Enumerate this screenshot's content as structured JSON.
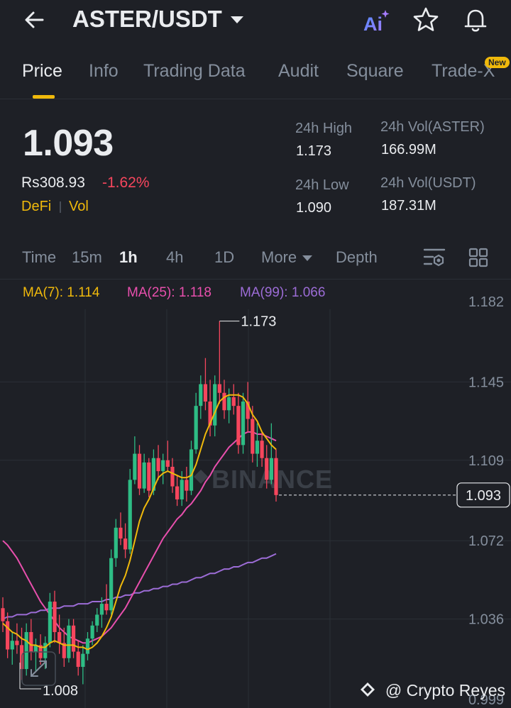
{
  "header": {
    "pair": "ASTER/USDT",
    "ai_label": "Ai"
  },
  "tabs": [
    {
      "label": "Price",
      "active": true
    },
    {
      "label": "Info"
    },
    {
      "label": "Trading Data"
    },
    {
      "label": "Audit"
    },
    {
      "label": "Square"
    },
    {
      "label": "Trade-X",
      "badge": "New"
    }
  ],
  "ticker": {
    "last_price": "1.093",
    "fiat_price": "Rs308.93",
    "change": "-1.62%",
    "tags": [
      "DeFi",
      "Vol"
    ],
    "stats": {
      "high_label": "24h High",
      "high_value": "1.173",
      "low_label": "24h Low",
      "low_value": "1.090",
      "vol_base_label": "24h Vol(ASTER)",
      "vol_base_value": "166.99M",
      "vol_quote_label": "24h Vol(USDT)",
      "vol_quote_value": "187.31M"
    }
  },
  "timeframes": [
    {
      "label": "Time"
    },
    {
      "label": "15m"
    },
    {
      "label": "1h",
      "active": true
    },
    {
      "label": "4h"
    },
    {
      "label": "1D"
    },
    {
      "label": "More"
    },
    {
      "label": "Depth"
    }
  ],
  "indicators": {
    "ma7": "MA(7): 1.114",
    "ma25": "MA(25): 1.118",
    "ma99": "MA(99): 1.066"
  },
  "colors": {
    "up": "#2ebd85",
    "down": "#f6465d",
    "ma7": "#f0b90b",
    "ma25": "#e84fad",
    "ma99": "#9c6cd6",
    "accent": "#f0b90b"
  },
  "chart_data": {
    "type": "candlestick",
    "y_ticks": [
      "1.182",
      "1.145",
      "1.109",
      "1.072",
      "1.036",
      "0.999"
    ],
    "ylim": [
      0.999,
      1.182
    ],
    "annotations": {
      "high": "1.173",
      "low": "1.008",
      "last": "1.093"
    },
    "grid": true,
    "candles": [
      {
        "o": 1.041,
        "h": 1.046,
        "l": 1.03,
        "c": 1.035
      },
      {
        "o": 1.035,
        "h": 1.039,
        "l": 1.018,
        "c": 1.022
      },
      {
        "o": 1.022,
        "h": 1.03,
        "l": 1.015,
        "c": 1.026
      },
      {
        "o": 1.026,
        "h": 1.034,
        "l": 1.02,
        "c": 1.024
      },
      {
        "o": 1.024,
        "h": 1.032,
        "l": 1.008,
        "c": 1.013
      },
      {
        "o": 1.013,
        "h": 1.034,
        "l": 1.01,
        "c": 1.03
      },
      {
        "o": 1.03,
        "h": 1.036,
        "l": 1.017,
        "c": 1.021
      },
      {
        "o": 1.021,
        "h": 1.027,
        "l": 1.012,
        "c": 1.024
      },
      {
        "o": 1.024,
        "h": 1.029,
        "l": 1.015,
        "c": 1.018
      },
      {
        "o": 1.018,
        "h": 1.028,
        "l": 1.013,
        "c": 1.025
      },
      {
        "o": 1.025,
        "h": 1.048,
        "l": 1.023,
        "c": 1.044
      },
      {
        "o": 1.044,
        "h": 1.049,
        "l": 1.025,
        "c": 1.03
      },
      {
        "o": 1.03,
        "h": 1.038,
        "l": 1.02,
        "c": 1.025
      },
      {
        "o": 1.025,
        "h": 1.032,
        "l": 1.014,
        "c": 1.018
      },
      {
        "o": 1.018,
        "h": 1.036,
        "l": 1.016,
        "c": 1.033
      },
      {
        "o": 1.033,
        "h": 1.036,
        "l": 1.018,
        "c": 1.021
      },
      {
        "o": 1.021,
        "h": 1.026,
        "l": 1.01,
        "c": 1.014
      },
      {
        "o": 1.014,
        "h": 1.024,
        "l": 1.006,
        "c": 1.02
      },
      {
        "o": 1.02,
        "h": 1.03,
        "l": 1.017,
        "c": 1.027
      },
      {
        "o": 1.027,
        "h": 1.035,
        "l": 1.024,
        "c": 1.033
      },
      {
        "o": 1.033,
        "h": 1.041,
        "l": 1.03,
        "c": 1.038
      },
      {
        "o": 1.038,
        "h": 1.046,
        "l": 1.032,
        "c": 1.043
      },
      {
        "o": 1.043,
        "h": 1.052,
        "l": 1.038,
        "c": 1.04
      },
      {
        "o": 1.04,
        "h": 1.068,
        "l": 1.038,
        "c": 1.064
      },
      {
        "o": 1.064,
        "h": 1.082,
        "l": 1.06,
        "c": 1.078
      },
      {
        "o": 1.078,
        "h": 1.085,
        "l": 1.07,
        "c": 1.073
      },
      {
        "o": 1.073,
        "h": 1.08,
        "l": 1.064,
        "c": 1.068
      },
      {
        "o": 1.068,
        "h": 1.105,
        "l": 1.066,
        "c": 1.1
      },
      {
        "o": 1.1,
        "h": 1.12,
        "l": 1.098,
        "c": 1.112
      },
      {
        "o": 1.112,
        "h": 1.116,
        "l": 1.093,
        "c": 1.096
      },
      {
        "o": 1.096,
        "h": 1.112,
        "l": 1.094,
        "c": 1.108
      },
      {
        "o": 1.108,
        "h": 1.11,
        "l": 1.092,
        "c": 1.095
      },
      {
        "o": 1.095,
        "h": 1.114,
        "l": 1.093,
        "c": 1.11
      },
      {
        "o": 1.11,
        "h": 1.116,
        "l": 1.1,
        "c": 1.104
      },
      {
        "o": 1.104,
        "h": 1.112,
        "l": 1.098,
        "c": 1.109
      },
      {
        "o": 1.109,
        "h": 1.118,
        "l": 1.104,
        "c": 1.106
      },
      {
        "o": 1.106,
        "h": 1.11,
        "l": 1.094,
        "c": 1.097
      },
      {
        "o": 1.097,
        "h": 1.102,
        "l": 1.088,
        "c": 1.091
      },
      {
        "o": 1.091,
        "h": 1.104,
        "l": 1.088,
        "c": 1.1
      },
      {
        "o": 1.1,
        "h": 1.106,
        "l": 1.09,
        "c": 1.095
      },
      {
        "o": 1.095,
        "h": 1.118,
        "l": 1.093,
        "c": 1.114
      },
      {
        "o": 1.114,
        "h": 1.14,
        "l": 1.112,
        "c": 1.134
      },
      {
        "o": 1.134,
        "h": 1.148,
        "l": 1.128,
        "c": 1.144
      },
      {
        "o": 1.144,
        "h": 1.156,
        "l": 1.132,
        "c": 1.136
      },
      {
        "o": 1.136,
        "h": 1.146,
        "l": 1.12,
        "c": 1.125
      },
      {
        "o": 1.125,
        "h": 1.148,
        "l": 1.12,
        "c": 1.144
      },
      {
        "o": 1.144,
        "h": 1.173,
        "l": 1.135,
        "c": 1.14
      },
      {
        "o": 1.14,
        "h": 1.146,
        "l": 1.128,
        "c": 1.132
      },
      {
        "o": 1.132,
        "h": 1.142,
        "l": 1.126,
        "c": 1.138
      },
      {
        "o": 1.138,
        "h": 1.144,
        "l": 1.13,
        "c": 1.134
      },
      {
        "o": 1.134,
        "h": 1.14,
        "l": 1.112,
        "c": 1.116
      },
      {
        "o": 1.116,
        "h": 1.14,
        "l": 1.112,
        "c": 1.136
      },
      {
        "o": 1.136,
        "h": 1.145,
        "l": 1.122,
        "c": 1.128
      },
      {
        "o": 1.128,
        "h": 1.134,
        "l": 1.108,
        "c": 1.112
      },
      {
        "o": 1.112,
        "h": 1.126,
        "l": 1.106,
        "c": 1.118
      },
      {
        "o": 1.118,
        "h": 1.122,
        "l": 1.106,
        "c": 1.11
      },
      {
        "o": 1.11,
        "h": 1.116,
        "l": 1.096,
        "c": 1.1
      },
      {
        "o": 1.1,
        "h": 1.126,
        "l": 1.098,
        "c": 1.11
      },
      {
        "o": 1.11,
        "h": 1.114,
        "l": 1.09,
        "c": 1.093
      }
    ],
    "ma7": [
      1.034,
      1.032,
      1.03,
      1.029,
      1.027,
      1.026,
      1.024,
      1.024,
      1.023,
      1.023,
      1.025,
      1.026,
      1.025,
      1.024,
      1.024,
      1.024,
      1.023,
      1.023,
      1.022,
      1.023,
      1.025,
      1.028,
      1.032,
      1.037,
      1.044,
      1.051,
      1.056,
      1.063,
      1.072,
      1.081,
      1.087,
      1.091,
      1.096,
      1.101,
      1.103,
      1.104,
      1.103,
      1.102,
      1.101,
      1.101,
      1.102,
      1.107,
      1.114,
      1.121,
      1.126,
      1.131,
      1.136,
      1.138,
      1.139,
      1.139,
      1.139,
      1.138,
      1.135,
      1.13,
      1.127,
      1.122,
      1.119,
      1.116,
      1.114
    ],
    "ma25": [
      1.072,
      1.07,
      1.067,
      1.064,
      1.06,
      1.056,
      1.052,
      1.048,
      1.044,
      1.041,
      1.038,
      1.035,
      1.032,
      1.03,
      1.028,
      1.027,
      1.026,
      1.025,
      1.025,
      1.026,
      1.027,
      1.028,
      1.03,
      1.032,
      1.035,
      1.038,
      1.041,
      1.045,
      1.049,
      1.053,
      1.057,
      1.061,
      1.065,
      1.069,
      1.073,
      1.076,
      1.079,
      1.082,
      1.084,
      1.087,
      1.089,
      1.092,
      1.095,
      1.099,
      1.102,
      1.106,
      1.109,
      1.112,
      1.115,
      1.117,
      1.119,
      1.121,
      1.122,
      1.122,
      1.121,
      1.121,
      1.12,
      1.119,
      1.118
    ],
    "ma99": [
      1.036,
      1.037,
      1.037,
      1.038,
      1.038,
      1.038,
      1.039,
      1.039,
      1.04,
      1.04,
      1.041,
      1.041,
      1.041,
      1.042,
      1.042,
      1.042,
      1.043,
      1.043,
      1.043,
      1.044,
      1.044,
      1.044,
      1.045,
      1.045,
      1.046,
      1.046,
      1.047,
      1.047,
      1.048,
      1.048,
      1.049,
      1.049,
      1.05,
      1.05,
      1.051,
      1.051,
      1.052,
      1.052,
      1.053,
      1.053,
      1.054,
      1.055,
      1.055,
      1.056,
      1.057,
      1.057,
      1.058,
      1.059,
      1.059,
      1.06,
      1.06,
      1.061,
      1.062,
      1.062,
      1.063,
      1.064,
      1.064,
      1.065,
      1.066
    ],
    "watermark": "BINANCE",
    "credit": "@ Crypto Reyes"
  }
}
